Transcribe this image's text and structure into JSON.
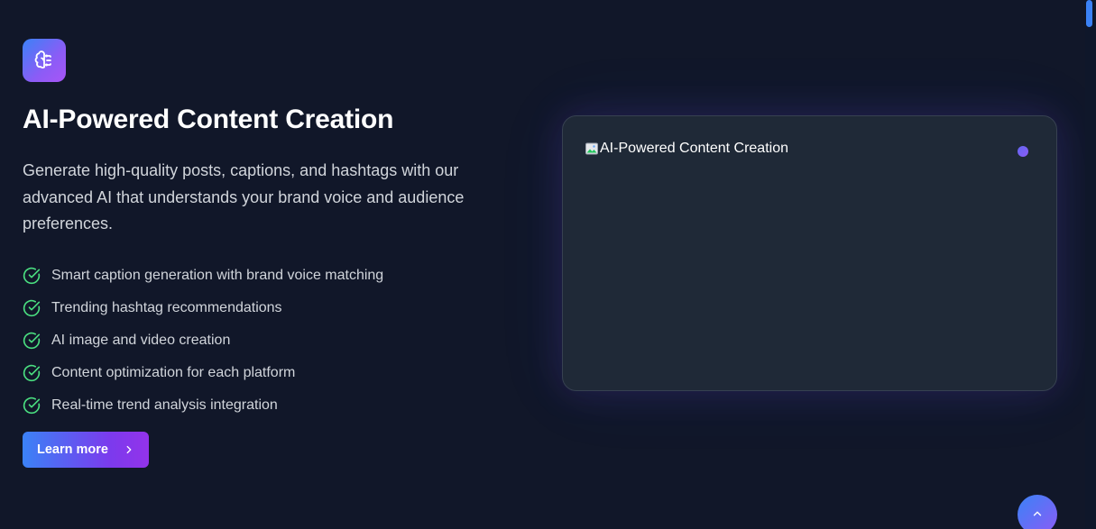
{
  "feature": {
    "icon": "brain-icon",
    "heading": "AI-Powered Content Creation",
    "description": "Generate high-quality posts, captions, and hashtags with our advanced AI that understands your brand voice and audience preferences.",
    "items": [
      {
        "label": "Smart caption generation with brand voice matching",
        "icon": "check-circle-icon"
      },
      {
        "label": "Trending hashtag recommendations",
        "icon": "check-circle-icon"
      },
      {
        "label": "AI image and video creation",
        "icon": "check-circle-icon"
      },
      {
        "label": "Content optimization for each platform",
        "icon": "check-circle-icon"
      },
      {
        "label": "Real-time trend analysis integration",
        "icon": "check-circle-icon"
      }
    ],
    "cta_label": "Learn more"
  },
  "preview": {
    "image_alt": "AI-Powered Content Creation"
  },
  "colors": {
    "background": "#111729",
    "accent_blue": "#3b82f6",
    "accent_purple": "#8b5cf6",
    "check_green": "#4ade80"
  }
}
